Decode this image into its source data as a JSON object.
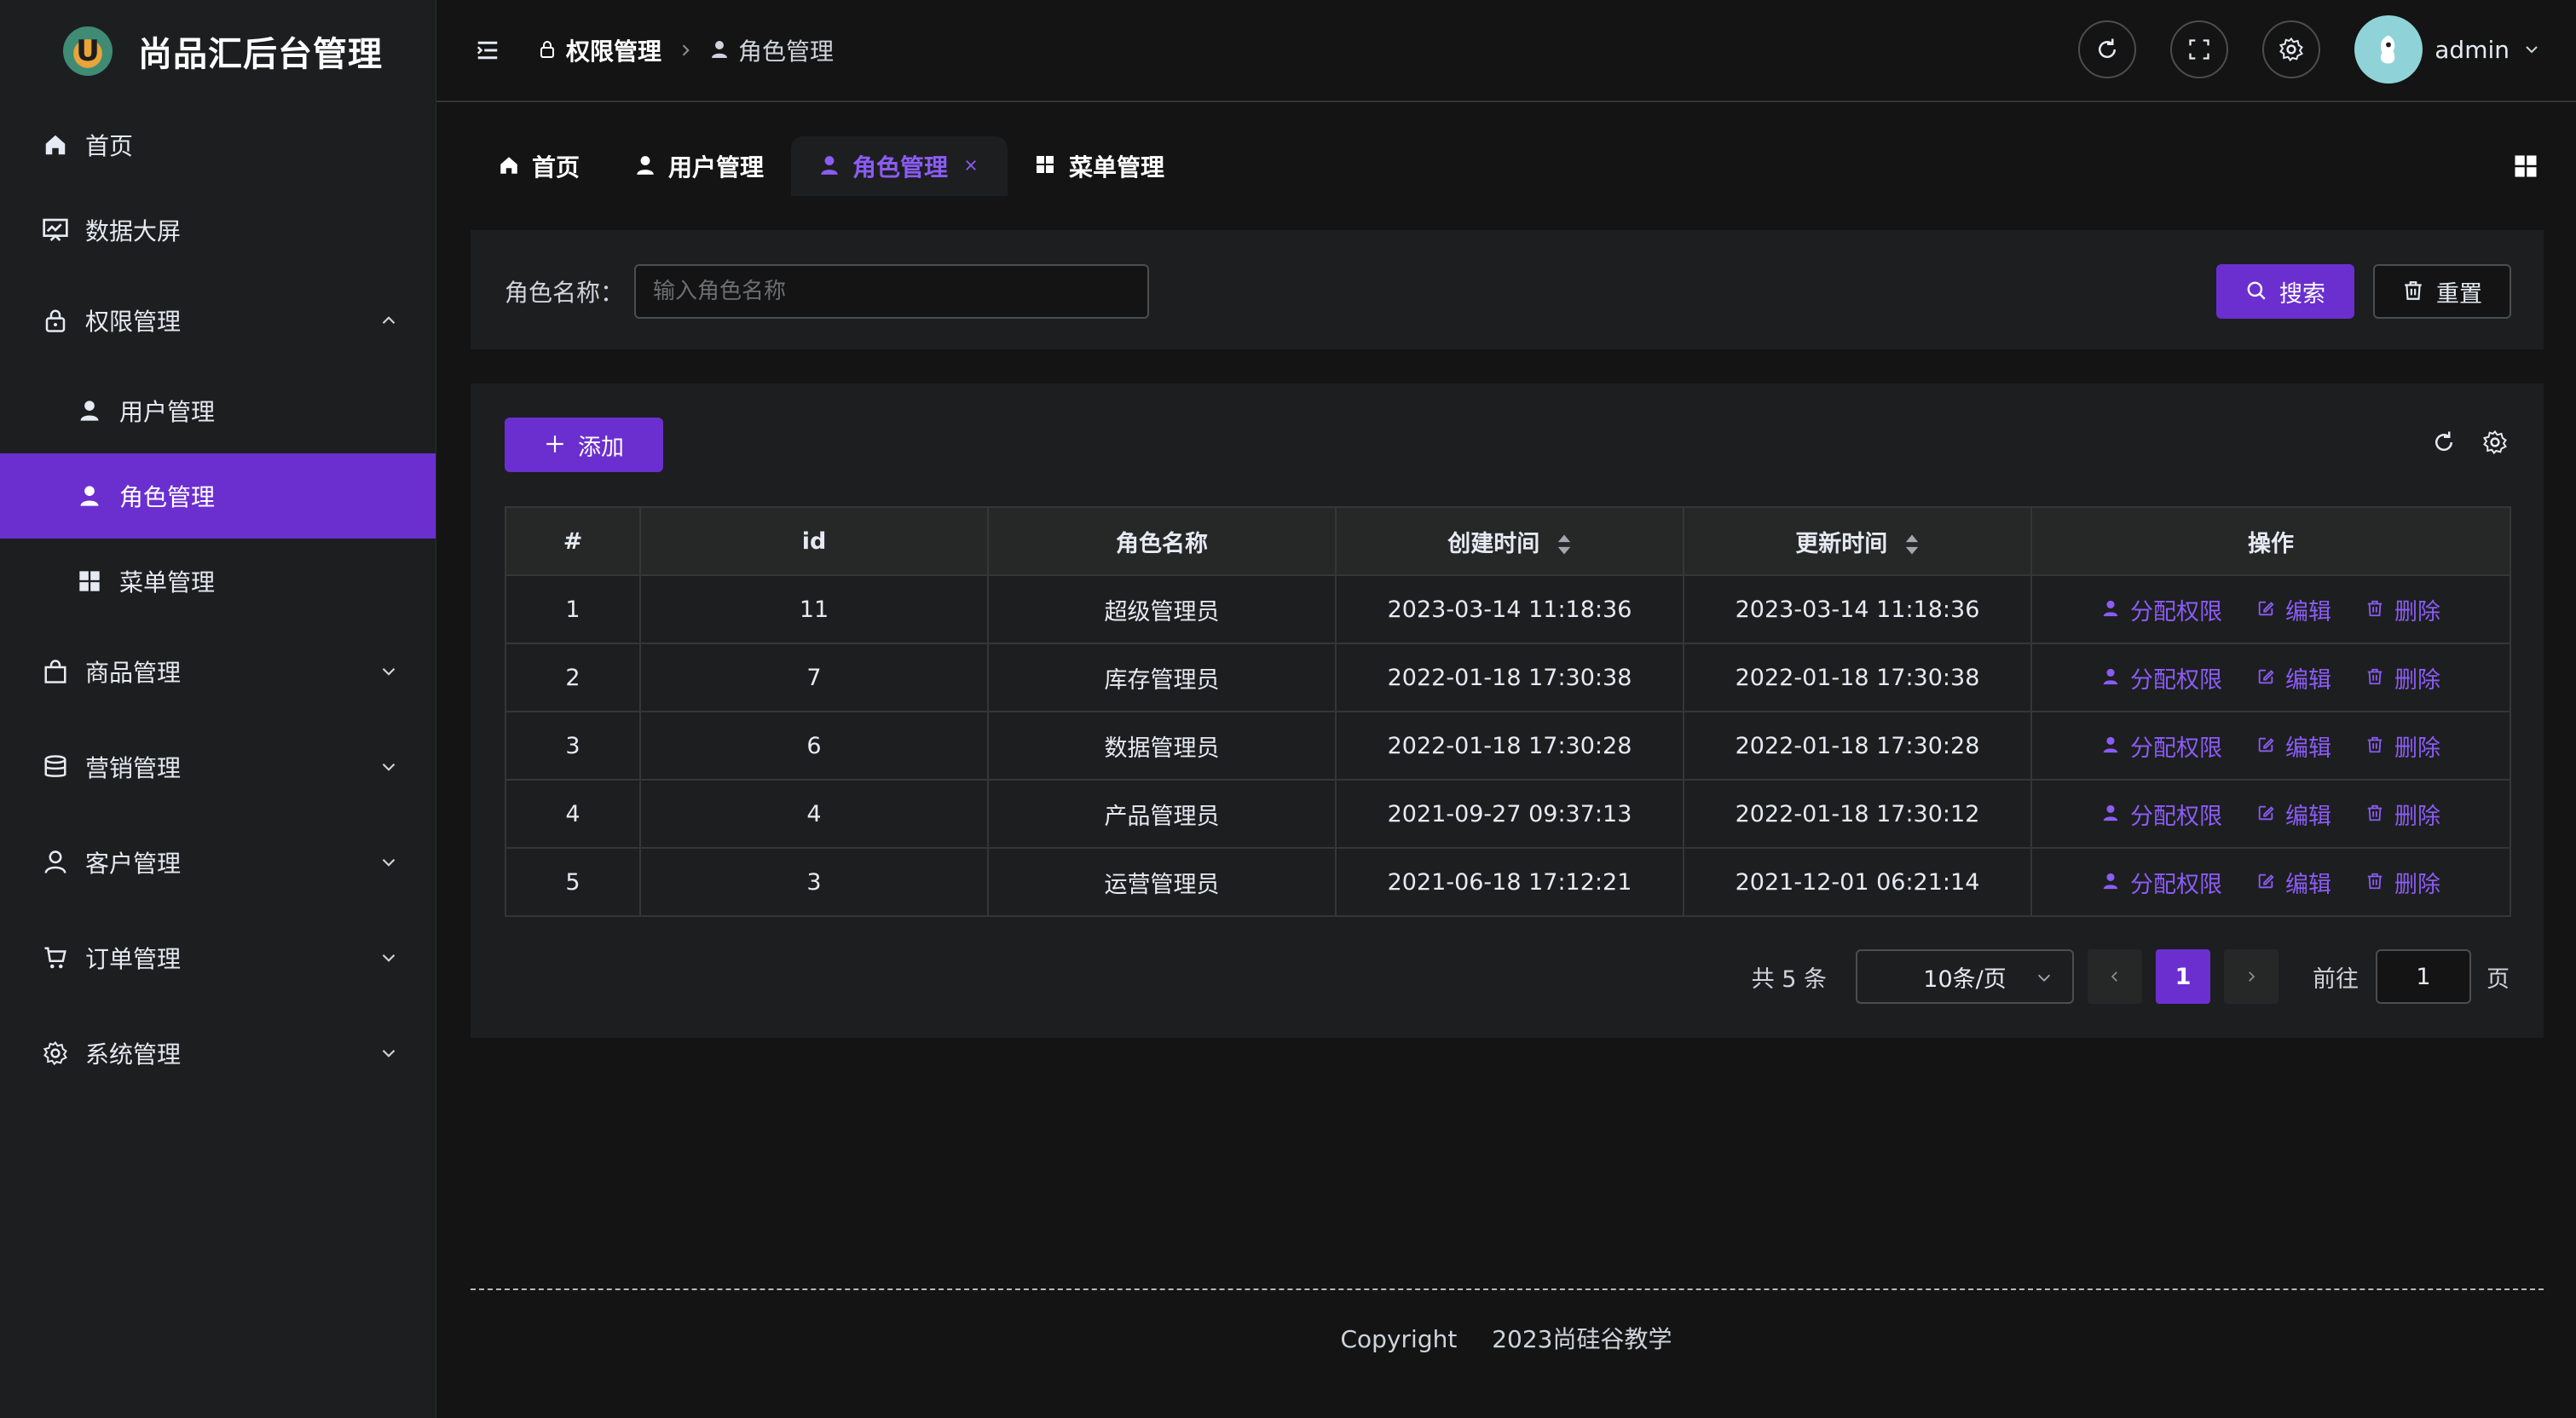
{
  "app": {
    "title": "尚品汇后台管理",
    "logo_letter": "U",
    "accent_color": "#6b2fd0"
  },
  "sidebar": {
    "items": [
      {
        "label": "首页",
        "icon": "home-icon"
      },
      {
        "label": "数据大屏",
        "icon": "monitor-chart-icon"
      },
      {
        "label": "权限管理",
        "icon": "lock-icon",
        "expanded": true
      },
      {
        "label": "用户管理",
        "icon": "user-icon"
      },
      {
        "label": "角色管理",
        "icon": "user-icon",
        "active": true
      },
      {
        "label": "菜单管理",
        "icon": "grid-icon"
      },
      {
        "label": "商品管理",
        "icon": "bag-icon"
      },
      {
        "label": "营销管理",
        "icon": "coins-icon"
      },
      {
        "label": "客户管理",
        "icon": "user-outline-icon"
      },
      {
        "label": "订单管理",
        "icon": "cart-icon"
      },
      {
        "label": "系统管理",
        "icon": "gear-icon"
      }
    ]
  },
  "header": {
    "breadcrumb": [
      "权限管理",
      "角色管理"
    ],
    "user_name": "admin"
  },
  "tabs": [
    {
      "label": "首页",
      "icon": "home-icon"
    },
    {
      "label": "用户管理",
      "icon": "user-icon"
    },
    {
      "label": "角色管理",
      "icon": "user-icon",
      "active": true
    },
    {
      "label": "菜单管理",
      "icon": "grid-icon"
    }
  ],
  "search": {
    "label": "角色名称：",
    "placeholder": "输入角色名称",
    "value": "",
    "search_label": "搜索",
    "reset_label": "重置"
  },
  "table": {
    "add_label": "添加",
    "columns": [
      "#",
      "id",
      "角色名称",
      "创建时间",
      "更新时间",
      "操作"
    ],
    "rows": [
      {
        "index": "1",
        "id": "11",
        "name": "超级管理员",
        "created": "2023-03-14 11:18:36",
        "updated": "2023-03-14 11:18:36"
      },
      {
        "index": "2",
        "id": "7",
        "name": "库存管理员",
        "created": "2022-01-18 17:30:38",
        "updated": "2022-01-18 17:30:38"
      },
      {
        "index": "3",
        "id": "6",
        "name": "数据管理员",
        "created": "2022-01-18 17:30:28",
        "updated": "2022-01-18 17:30:28"
      },
      {
        "index": "4",
        "id": "4",
        "name": "产品管理员",
        "created": "2021-09-27 09:37:13",
        "updated": "2022-01-18 17:30:12"
      },
      {
        "index": "5",
        "id": "3",
        "name": "运营管理员",
        "created": "2021-06-18 17:12:21",
        "updated": "2021-12-01 06:21:14"
      }
    ],
    "actions": {
      "assign": "分配权限",
      "edit": "编辑",
      "delete": "删除"
    }
  },
  "pagination": {
    "total_text": "共 5 条",
    "page_size": "10条/页",
    "current_page": "1",
    "goto_label": "前往",
    "goto_value": "1",
    "goto_unit": "页"
  },
  "footer": {
    "copyright": "Copyright",
    "org": "2023尚硅谷教学"
  }
}
